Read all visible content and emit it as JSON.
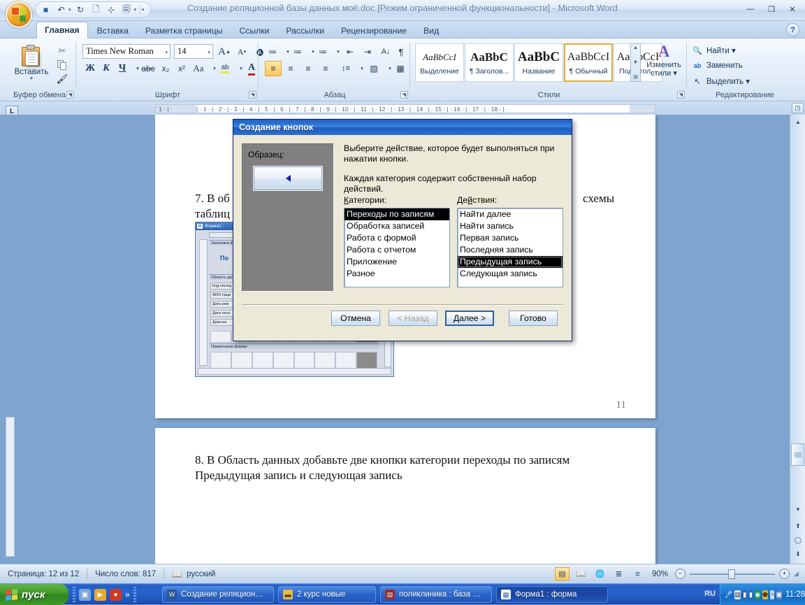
{
  "titlebar": {
    "document_title": "Создание реляционной базы данных моё.doc [Режим ограниченной функциональности] - Microsoft Word",
    "quick_access": [
      {
        "name": "save",
        "glyph": "💾"
      },
      {
        "name": "undo",
        "glyph": "↶"
      },
      {
        "name": "redo",
        "glyph": "↻"
      },
      {
        "name": "new",
        "glyph": "🗋"
      },
      {
        "name": "table",
        "glyph": "⊞"
      },
      {
        "name": "print-preview",
        "glyph": "🗐"
      }
    ],
    "qat_more": "▾",
    "window_buttons": {
      "minimize": "—",
      "restore": "❐",
      "close": "✕"
    }
  },
  "tabs": [
    {
      "label": "Главная",
      "active": true
    },
    {
      "label": "Вставка",
      "active": false
    },
    {
      "label": "Разметка страницы",
      "active": false
    },
    {
      "label": "Ссылки",
      "active": false
    },
    {
      "label": "Рассылки",
      "active": false
    },
    {
      "label": "Рецензирование",
      "active": false
    },
    {
      "label": "Вид",
      "active": false
    }
  ],
  "help_label": "?",
  "ribbon": {
    "clipboard": {
      "title": "Буфер обмена",
      "paste_label": "Вставить",
      "paste_arrow": "▾",
      "cut_icon": "✂",
      "copy_icon": "copy",
      "format_painter_icon": "🖌"
    },
    "font": {
      "title": "Шрифт",
      "font_name": "Times New Roman",
      "font_size": "14",
      "grow_font": "A",
      "shrink_font": "A",
      "clear_format": "Aa",
      "bold": "Ж",
      "italic": "К",
      "underline": "Ч",
      "strikethrough": "abc",
      "subscript": "x₂",
      "superscript": "x²",
      "change_case": "Aa",
      "highlight": "ab",
      "font_color": "A"
    },
    "paragraph": {
      "title": "Абзац",
      "bullets": "≔",
      "numbering": "≔",
      "multilevel": "≔",
      "decrease_indent": "⇤",
      "increase_indent": "⇥",
      "sort": "A↓",
      "show_marks": "¶",
      "align_left": "≡",
      "align_center": "≡",
      "align_right": "≡",
      "justify": "≡",
      "line_spacing": "↕≡",
      "shading": "▧",
      "borders": "▦"
    },
    "styles": {
      "title": "Стили",
      "tiles": [
        {
          "preview": "AaBbCcI",
          "name": "Выделение",
          "selected": false,
          "italic": true
        },
        {
          "preview": "AaBbC",
          "name": "¶ Заголов...",
          "selected": false,
          "italic": false
        },
        {
          "preview": "AaBbC",
          "name": "Название",
          "selected": false,
          "italic": false
        },
        {
          "preview": "AaBbCcI",
          "name": "¶ Обычный",
          "selected": true,
          "italic": false
        },
        {
          "preview": "AaBbCcI",
          "name": "Подзагол...",
          "selected": false,
          "italic": false
        }
      ],
      "change_styles_label_line1": "Изменить",
      "change_styles_label_line2": "стили ▾",
      "scroll_up": "▲",
      "scroll_down": "▼",
      "scroll_more": "▤"
    },
    "editing": {
      "title": "Редактирование",
      "items": [
        {
          "label": "Найти ▾",
          "icon": "🔍"
        },
        {
          "label": "Заменить",
          "icon": "ab"
        },
        {
          "label": "Выделить ▾",
          "icon": "↖"
        }
      ]
    }
  },
  "ruler": {
    "tab_selector": "L",
    "marks": [
      "1",
      "1",
      "2",
      "3",
      "4",
      "5",
      "6",
      "7",
      "8",
      "9",
      "10",
      "11",
      "12",
      "13",
      "14",
      "15",
      "16",
      "17",
      "18"
    ]
  },
  "document": {
    "page1": {
      "line1": "7. В об",
      "line2": "таблиц",
      "right_fragment": "схемы",
      "page_number": "11",
      "access_window": {
        "title": "Форма1 :",
        "header_section": "Заголовок формы",
        "detail_section": "Область данных",
        "footer_section": "Примечание формы",
        "header_text": "По",
        "fields": [
          "Код посещ",
          "ФИО паци",
          "Дата рож",
          "Дата посе",
          "Диагноз"
        ]
      }
    },
    "page2": {
      "line1": "8. В Область данных добавьте  две кнопки категории переходы по записям",
      "line2": "Предыдущая запись и следующая запись"
    }
  },
  "dialog": {
    "title": "Создание кнопок",
    "sample_label": "Образец:",
    "sample_button_glyph": "◀",
    "description1": "Выберите действие, которое будет выполняться при нажатии кнопки.",
    "description2": "Каждая категория содержит собственный набор действий.",
    "categories_label": "Категории:",
    "actions_label": "Действия:",
    "categories": [
      {
        "label": "Переходы по записям",
        "selected": true
      },
      {
        "label": "Обработка записей",
        "selected": false
      },
      {
        "label": "Работа с формой",
        "selected": false
      },
      {
        "label": "Работа с отчетом",
        "selected": false
      },
      {
        "label": "Приложение",
        "selected": false
      },
      {
        "label": "Разное",
        "selected": false
      }
    ],
    "actions": [
      {
        "label": "Найти далее",
        "selected": false
      },
      {
        "label": "Найти запись",
        "selected": false
      },
      {
        "label": "Первая запись",
        "selected": false
      },
      {
        "label": "Последняя запись",
        "selected": false
      },
      {
        "label": "Предыдущая запись",
        "selected": true
      },
      {
        "label": "Следующая запись",
        "selected": false
      }
    ],
    "buttons": [
      {
        "label": "Отмена",
        "state": "normal"
      },
      {
        "label": "< Назад",
        "state": "disabled"
      },
      {
        "label": "Далее >",
        "state": "default"
      },
      {
        "label": "Готово",
        "state": "normal"
      }
    ]
  },
  "statusbar": {
    "page_info": "Страница: 12 из 12",
    "word_count": "Число слов: 817",
    "language": "русский",
    "proofing_icon": "spellcheck-icon",
    "zoom_level": "90%",
    "view_buttons": [
      "print-layout",
      "full-screen-reading",
      "web-layout",
      "outline",
      "draft"
    ],
    "zoom_out": "−",
    "zoom_in": "+"
  },
  "taskbar": {
    "start_label": "пуск",
    "quick_launch": [
      {
        "name": "show-desktop",
        "glyph": "▣"
      },
      {
        "name": "media-player",
        "glyph": "▶"
      },
      {
        "name": "browser",
        "glyph": "●"
      }
    ],
    "quick_launch_more": "»",
    "buttons": [
      {
        "label": "Создание реляцион…",
        "icon": "W",
        "active": false
      },
      {
        "label": "2 курс новые",
        "icon": "📁",
        "active": false
      },
      {
        "label": "поликлиника : база …",
        "icon": "A",
        "active": false
      },
      {
        "label": "Форма1 : форма",
        "icon": "▤",
        "active": true
      }
    ],
    "language_indicator": "RU",
    "tray_icons": [
      "pen-icon",
      "note-icon",
      "network-icon",
      "network2-icon",
      "media-icon",
      "shield-icon",
      "clock-icon",
      "security-icon"
    ],
    "clock": "11:28"
  },
  "colors": {
    "accent_blue": "#2a63c8",
    "title_gradient_start": "#1f60c4",
    "selection_black": "#000000",
    "ribbon_highlight": "#fcc85c",
    "desktop_blue": "#7ea4cf"
  }
}
